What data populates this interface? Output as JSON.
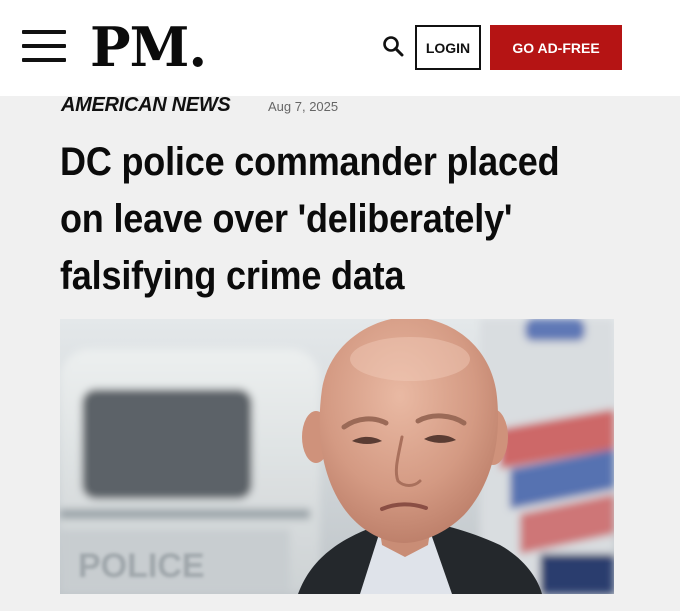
{
  "header": {
    "logo": "PM.",
    "menu_icon": "hamburger-menu-icon",
    "search_icon": "search-icon",
    "login_label": "LOGIN",
    "adfree_label": "GO AD-FREE",
    "brand_color": "#b51414"
  },
  "article": {
    "category": "AMERICAN NEWS",
    "date": "Aug 7, 2025",
    "headline": "DC police commander placed on leave over 'deliberately' falsifying crime data",
    "image": {
      "subject": "photo-of-bald-man",
      "van_lettering": "POLICE"
    }
  }
}
